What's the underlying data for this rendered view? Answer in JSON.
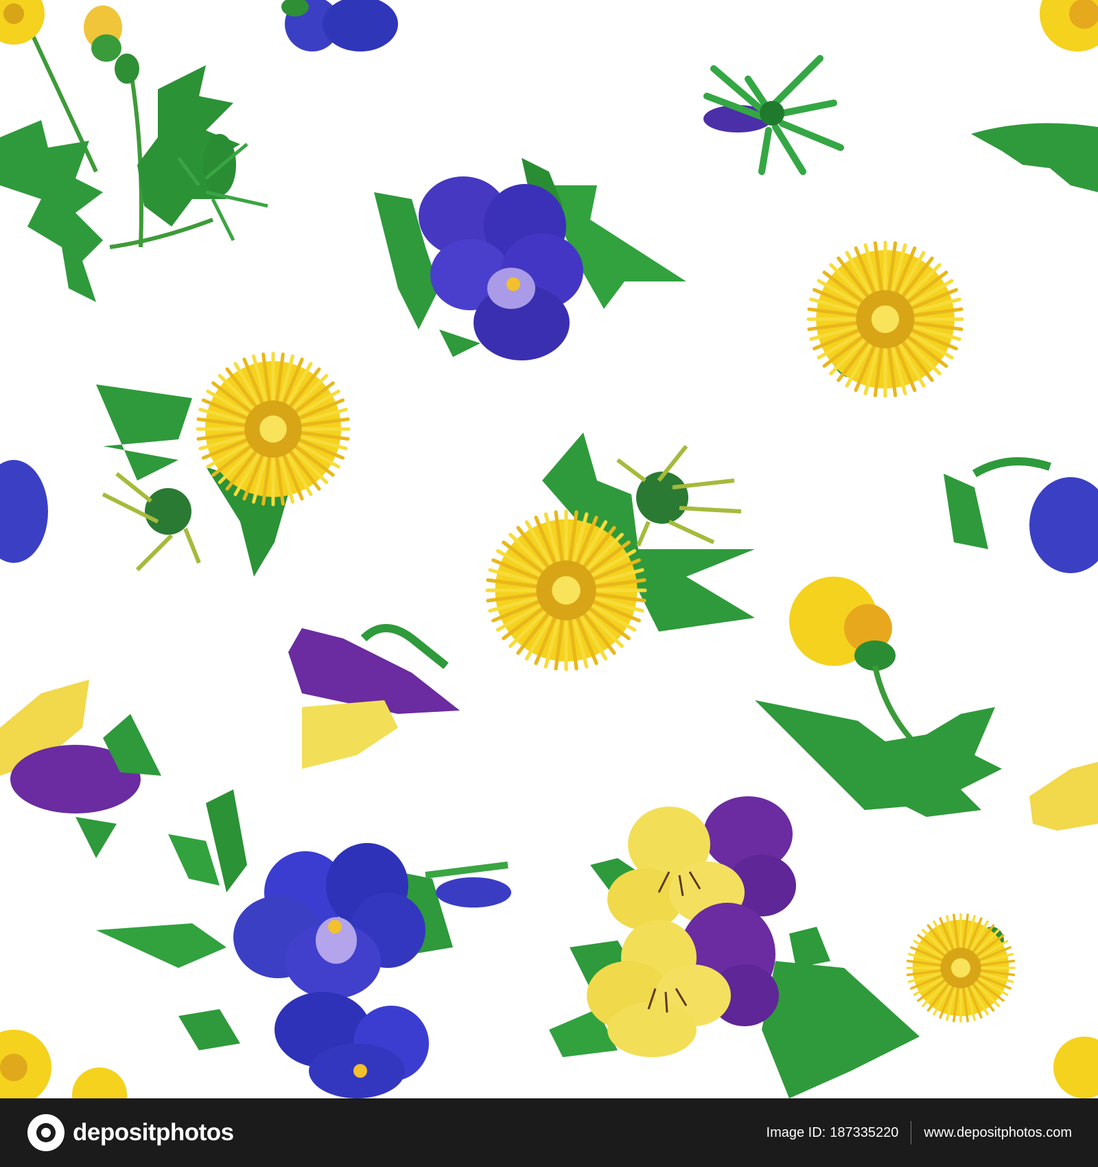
{
  "image": {
    "subject": "seamless watercolor pattern of dandelions and pansies",
    "palette": {
      "background": "#ffffff",
      "dandelion_yellow": "#f4d21e",
      "dandelion_center": "#d8a517",
      "pansy_blue": "#3b3fc4",
      "pansy_violet": "#6a2ca0",
      "pansy_yellow": "#f2df57",
      "leaf_green": "#37a844",
      "leaf_dark": "#1f7a2e"
    }
  },
  "footer": {
    "brand": "depositphotos",
    "image_id_label": "Image ID:",
    "image_id": "187335220",
    "website": "www.depositphotos.com",
    "background": "#1b1b1b"
  }
}
